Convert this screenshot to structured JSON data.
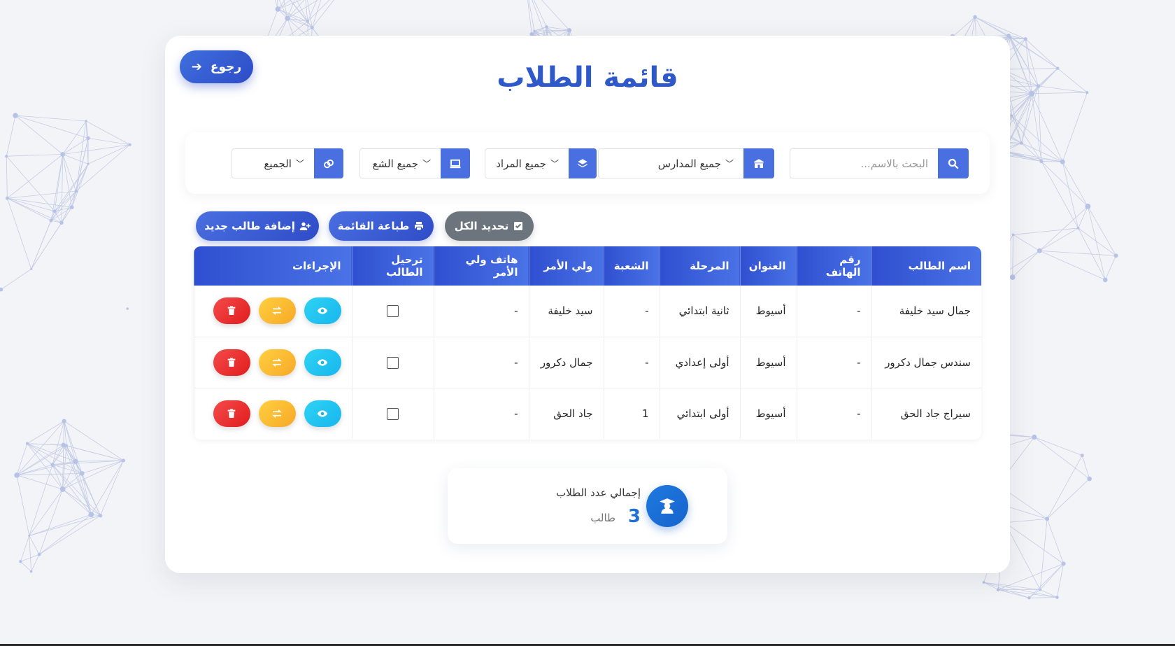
{
  "page": {
    "title": "قائمة الطلاب",
    "back_label": "رجوع"
  },
  "filters": {
    "search_placeholder": "البحث بالاسم...",
    "schools": "جميع المدارس",
    "subjects": "جميع المراد",
    "sections": "جميع الشع",
    "gender": "الجميع"
  },
  "actions": {
    "select_all": "تحديد الكل",
    "print": "طباعة القائمة",
    "add": "إضافة طالب جديد"
  },
  "table": {
    "headers": [
      "اسم الطالب",
      "رقم الهاتف",
      "العنوان",
      "المرحلة",
      "الشعبة",
      "ولي الأمر",
      "هاتف ولي الأمر",
      "ترحيل الطالب",
      "الإجراءات"
    ],
    "rows": [
      {
        "name": "جمال سيد خليفة",
        "phone": "-",
        "address": "أسيوط",
        "stage": "ثانية ابتدائي",
        "section": "-",
        "guardian": "سيد خليفة",
        "guardian_phone": "-"
      },
      {
        "name": "سندس جمال دكرور",
        "phone": "-",
        "address": "أسيوط",
        "stage": "أولى إعدادي",
        "section": "-",
        "guardian": "جمال دكرور",
        "guardian_phone": "-"
      },
      {
        "name": "سيراج جاد الحق",
        "phone": "-",
        "address": "أسيوط",
        "stage": "أولى ابتدائي",
        "section": "1",
        "guardian": "جاد الحق",
        "guardian_phone": "-"
      }
    ]
  },
  "summary": {
    "label": "إجمالي عدد الطلاب",
    "count": "3",
    "unit": "طالب"
  },
  "colors": {
    "primary": "#2f58c9",
    "view": "#17b6ee",
    "move": "#f7a928",
    "delete": "#e11d1d"
  }
}
